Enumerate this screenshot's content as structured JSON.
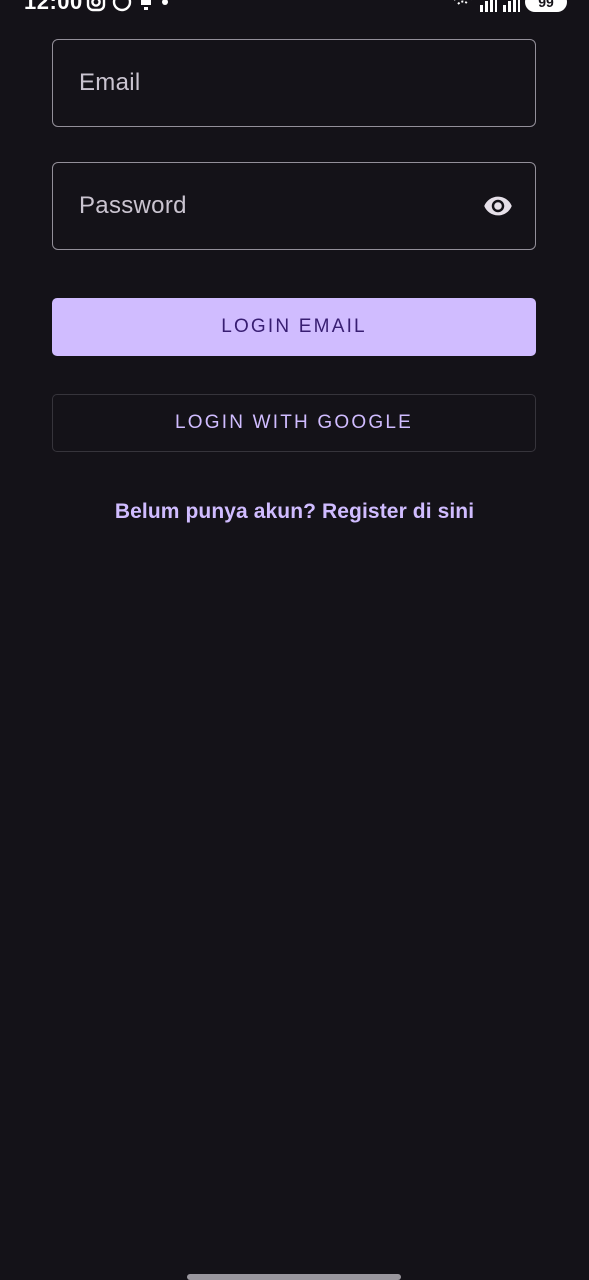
{
  "status_bar": {
    "time": "12:00",
    "battery": "99",
    "icons_left": [
      "instagram-icon",
      "whatsapp-icon",
      "notification-icon",
      "dot-icon"
    ],
    "icons_right": [
      "wifi-icon",
      "signal-icon",
      "signal-icon-2",
      "battery-icon"
    ]
  },
  "form": {
    "email_placeholder": "Email",
    "password_placeholder": "Password",
    "password_toggle_icon": "eye-icon"
  },
  "buttons": {
    "login_email": "LOGIN EMAIL",
    "login_google": "LOGIN WITH GOOGLE"
  },
  "register_link": "Belum punya akun? Register di sini",
  "colors": {
    "background": "#141218",
    "primary": "#d0bcff",
    "on_primary": "#381e72",
    "outline": "#938f99"
  }
}
